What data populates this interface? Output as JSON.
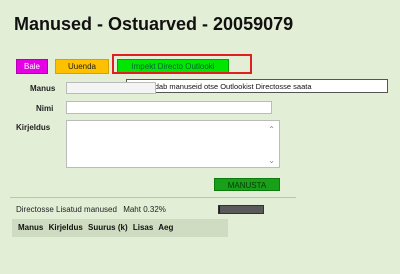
{
  "page": {
    "title": "Manused - Ostuarved - 20059079"
  },
  "toolbar": {
    "back_label": "Bale",
    "new_label": "Uuenda",
    "import_label": "Impekt Directo Outlooki"
  },
  "tooltip": {
    "text": "VSimaldab manuseid otse Outlookist Directosse saata"
  },
  "form": {
    "manus_label": "Manus",
    "manus_value": "",
    "nimi_label": "Nimi",
    "nimi_value": "",
    "kirjeldus_label": "Kirjeldus",
    "kirjeldus_value": "",
    "save_label": "MANUSTA"
  },
  "status": {
    "label": "Directosse Lisatud manused",
    "value": "Maht 0.32%",
    "used_fraction": 0.0032
  },
  "table": {
    "columns": [
      "Manus",
      "Kirjeldus",
      "Suurus (k)",
      "Lisas",
      "Aeg"
    ]
  },
  "colors": {
    "background": "#e3eed6",
    "back_button": "#e600e6",
    "new_button": "#ffc000",
    "import_button": "#00e600",
    "highlight_border": "#e02020",
    "save_button": "#18a018"
  },
  "icons": {
    "scroll_up": "chevron-up-icon",
    "scroll_down": "chevron-down-icon"
  }
}
